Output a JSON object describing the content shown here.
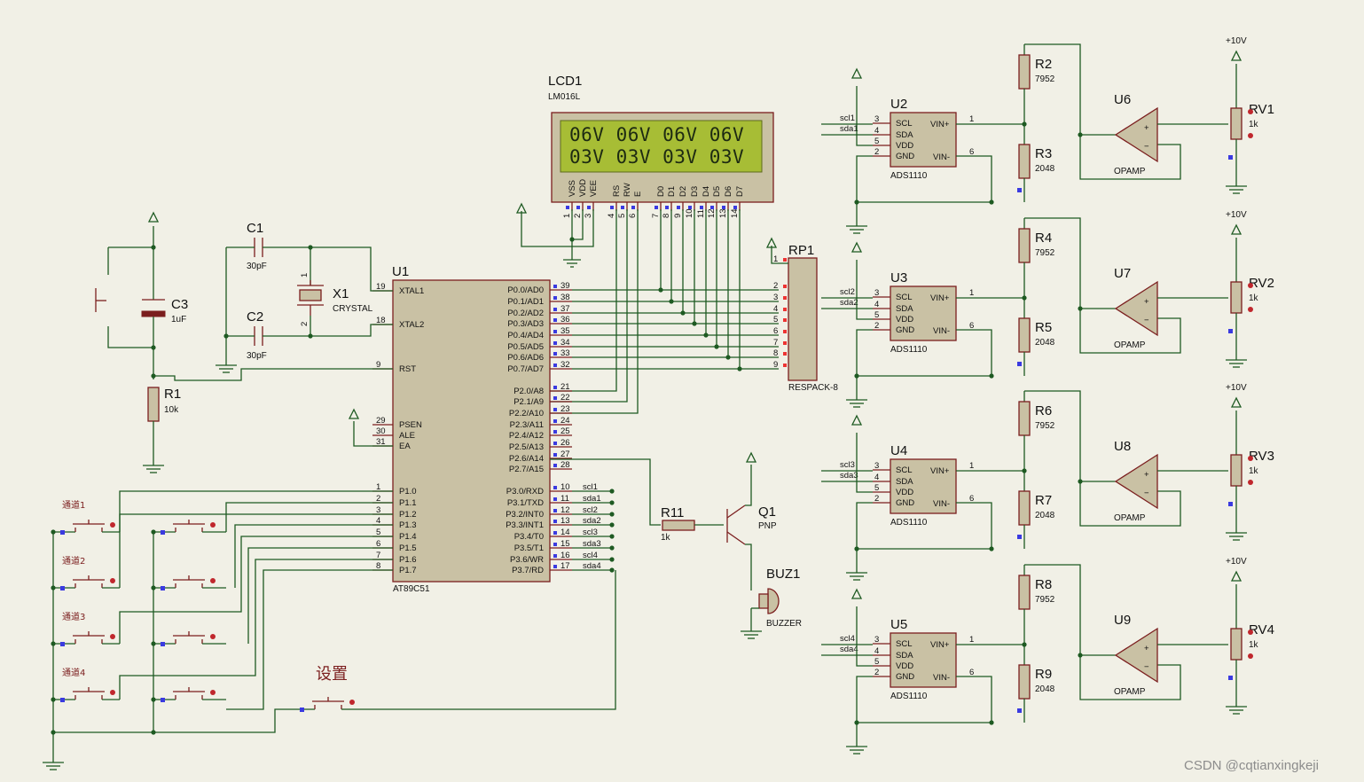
{
  "lcd": {
    "ref": "LCD1",
    "model": "LM016L",
    "line1": "06V 06V 06V 06V",
    "line2": "03V 03V 03V 03V",
    "pins": [
      {
        "label": "VSS",
        "num": "1"
      },
      {
        "label": "VDD",
        "num": "2"
      },
      {
        "label": "VEE",
        "num": "3"
      },
      {
        "label": "RS",
        "num": "4"
      },
      {
        "label": "RW",
        "num": "5"
      },
      {
        "label": "E",
        "num": "6"
      },
      {
        "label": "D0",
        "num": "7"
      },
      {
        "label": "D1",
        "num": "8"
      },
      {
        "label": "D2",
        "num": "9"
      },
      {
        "label": "D3",
        "num": "10"
      },
      {
        "label": "D4",
        "num": "11"
      },
      {
        "label": "D5",
        "num": "12"
      },
      {
        "label": "D6",
        "num": "13"
      },
      {
        "label": "D7",
        "num": "14"
      }
    ]
  },
  "mcu": {
    "ref": "U1",
    "model": "AT89C51",
    "left_pins": [
      {
        "label": "XTAL1",
        "num": "19"
      },
      {
        "label": "XTAL2",
        "num": "18"
      },
      {
        "label": "RST",
        "num": "9"
      },
      {
        "label": "PSEN",
        "num": "29"
      },
      {
        "label": "ALE",
        "num": "30"
      },
      {
        "label": "EA",
        "num": "31"
      },
      {
        "label": "P1.0",
        "num": "1"
      },
      {
        "label": "P1.1",
        "num": "2"
      },
      {
        "label": "P1.2",
        "num": "3"
      },
      {
        "label": "P1.3",
        "num": "4"
      },
      {
        "label": "P1.4",
        "num": "5"
      },
      {
        "label": "P1.5",
        "num": "6"
      },
      {
        "label": "P1.6",
        "num": "7"
      },
      {
        "label": "P1.7",
        "num": "8"
      }
    ],
    "right_pins": [
      {
        "label": "P0.0/AD0",
        "num": "39"
      },
      {
        "label": "P0.1/AD1",
        "num": "38"
      },
      {
        "label": "P0.2/AD2",
        "num": "37"
      },
      {
        "label": "P0.3/AD3",
        "num": "36"
      },
      {
        "label": "P0.4/AD4",
        "num": "35"
      },
      {
        "label": "P0.5/AD5",
        "num": "34"
      },
      {
        "label": "P0.6/AD6",
        "num": "33"
      },
      {
        "label": "P0.7/AD7",
        "num": "32"
      },
      {
        "label": "P2.0/A8",
        "num": "21"
      },
      {
        "label": "P2.1/A9",
        "num": "22"
      },
      {
        "label": "P2.2/A10",
        "num": "23"
      },
      {
        "label": "P2.3/A11",
        "num": "24"
      },
      {
        "label": "P2.4/A12",
        "num": "25"
      },
      {
        "label": "P2.5/A13",
        "num": "26"
      },
      {
        "label": "P2.6/A14",
        "num": "27"
      },
      {
        "label": "P2.7/A15",
        "num": "28"
      },
      {
        "label": "P3.0/RXD",
        "num": "10",
        "net": "scl1"
      },
      {
        "label": "P3.1/TXD",
        "num": "11",
        "net": "sda1"
      },
      {
        "label": "P3.2/INT0",
        "num": "12",
        "net": "scl2"
      },
      {
        "label": "P3.3/INT1",
        "num": "13",
        "net": "sda2"
      },
      {
        "label": "P3.4/T0",
        "num": "14",
        "net": "scl3"
      },
      {
        "label": "P3.5/T1",
        "num": "15",
        "net": "sda3"
      },
      {
        "label": "P3.6/WR",
        "num": "16",
        "net": "scl4"
      },
      {
        "label": "P3.7/RD",
        "num": "17",
        "net": "sda4"
      }
    ]
  },
  "passives": {
    "c1": {
      "ref": "C1",
      "val": "30pF"
    },
    "c2": {
      "ref": "C2",
      "val": "30pF"
    },
    "c3": {
      "ref": "C3",
      "val": "1uF"
    },
    "x1": {
      "ref": "X1",
      "val": "CRYSTAL",
      "pins": [
        "1",
        "2"
      ]
    },
    "r1": {
      "ref": "R1",
      "val": "10k"
    },
    "r11": {
      "ref": "R11",
      "val": "1k"
    },
    "q1": {
      "ref": "Q1",
      "val": "PNP"
    },
    "buz1": {
      "ref": "BUZ1",
      "val": "BUZZER"
    },
    "rp1": {
      "ref": "RP1",
      "val": "RESPACK-8",
      "pins": [
        "1",
        "2",
        "3",
        "4",
        "5",
        "6",
        "7",
        "8",
        "9"
      ]
    }
  },
  "buttons": {
    "channels": [
      "通道1",
      "通道2",
      "通道3",
      "通道4"
    ],
    "setting": "设置"
  },
  "adc_blocks": [
    {
      "ref": "U2",
      "scl": "scl1",
      "sda": "sda1",
      "r_top": "R2",
      "r_bot": "R3",
      "amp": "U6",
      "pot": "RV1"
    },
    {
      "ref": "U3",
      "scl": "scl2",
      "sda": "sda2",
      "r_top": "R4",
      "r_bot": "R5",
      "amp": "U7",
      "pot": "RV2"
    },
    {
      "ref": "U4",
      "scl": "scl3",
      "sda": "sda3",
      "r_top": "R6",
      "r_bot": "R7",
      "amp": "U8",
      "pot": "RV3"
    },
    {
      "ref": "U5",
      "scl": "scl4",
      "sda": "sda4",
      "r_top": "R8",
      "r_bot": "R9",
      "amp": "U9",
      "pot": "RV4"
    }
  ],
  "adc_common": {
    "model": "ADS1110",
    "pin_labels": [
      "SCL",
      "SDA",
      "VDD",
      "GND",
      "VIN+",
      "VIN-"
    ],
    "pin_nums": [
      "3",
      "4",
      "5",
      "2",
      "1",
      "6"
    ],
    "r_top_val": "7952",
    "r_bot_val": "2048",
    "amp_model": "OPAMP",
    "supply": "+10V",
    "pot_val": "1k"
  },
  "watermark": "CSDN @cqtianxingkeji"
}
